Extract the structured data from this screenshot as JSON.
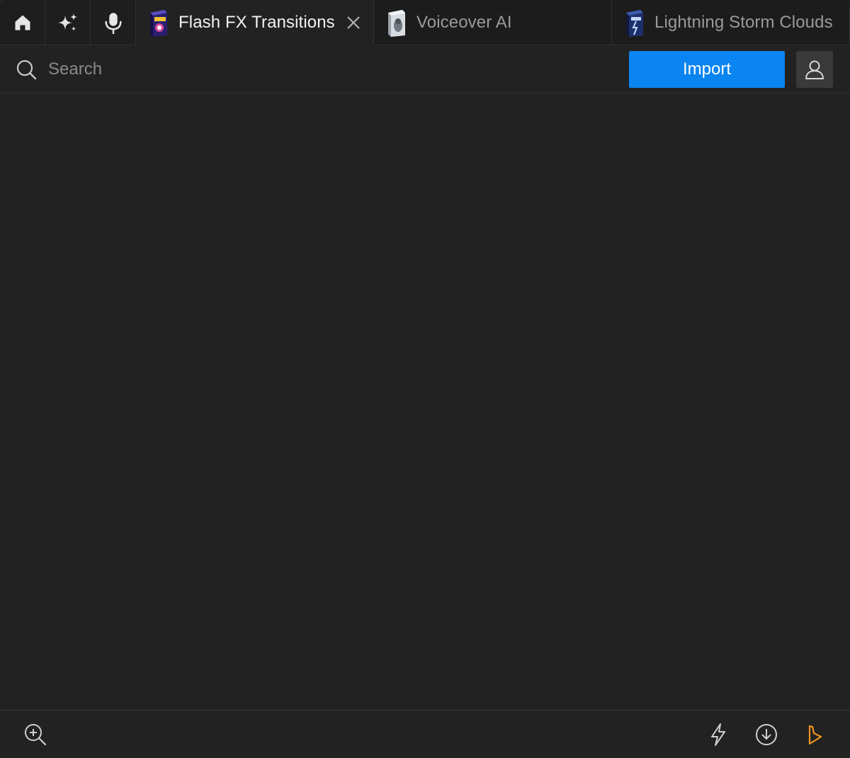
{
  "tabs": {
    "icon_tabs": [
      {
        "icon": "home-icon"
      },
      {
        "icon": "sparkles-icon"
      },
      {
        "icon": "microphone-icon"
      }
    ],
    "documents": [
      {
        "label": "Flash FX Transitions",
        "active": true
      },
      {
        "label": "Voiceover AI",
        "active": false
      },
      {
        "label": "Lightning Storm Clouds",
        "active": false
      }
    ]
  },
  "toolbar": {
    "search_placeholder": "Search",
    "import_label": "Import",
    "accent_color": "#0a84f0"
  },
  "footer": {
    "left_icons": [
      "zoom-in-icon"
    ],
    "right_icons": [
      "lightning-icon",
      "download-icon",
      "brand-logo-icon"
    ],
    "brand_color": "#f0941e"
  }
}
